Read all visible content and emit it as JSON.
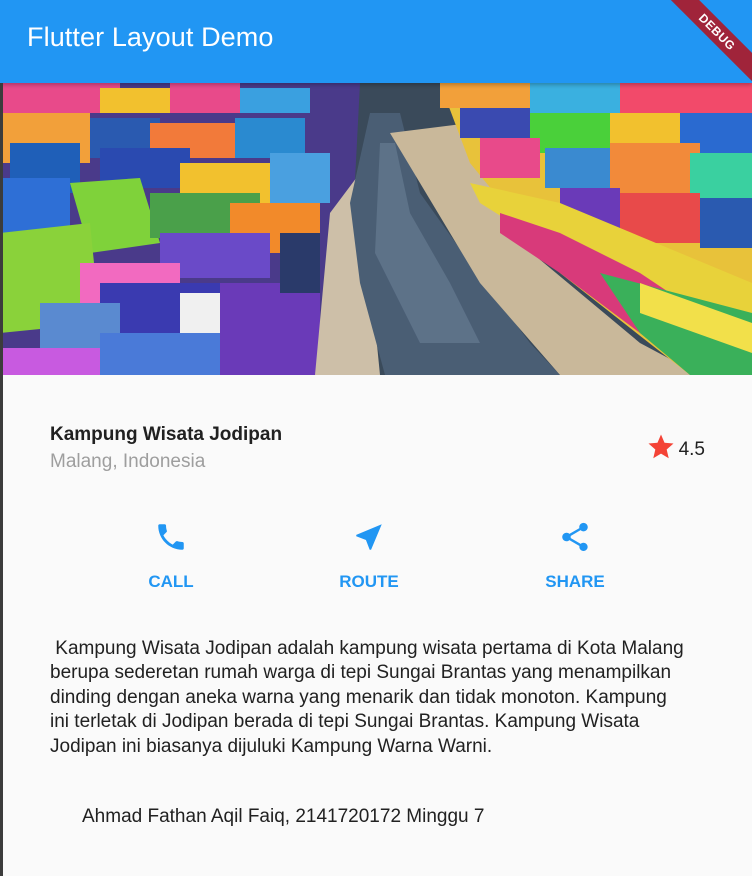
{
  "app_bar": {
    "title": "Flutter Layout Demo"
  },
  "debug_banner": {
    "label": "DEBUG"
  },
  "title_section": {
    "name": "Kampung Wisata Jodipan",
    "location": "Malang, Indonesia",
    "rating": "4.5",
    "star_icon": "star-icon",
    "star_color": "#f44336"
  },
  "buttons": [
    {
      "label": "CALL",
      "icon": "phone-icon"
    },
    {
      "label": "ROUTE",
      "icon": "navigation-icon"
    },
    {
      "label": "SHARE",
      "icon": "share-icon"
    }
  ],
  "description": " Kampung Wisata Jodipan adalah kampung wisata pertama di Kota Malang berupa sederetan rumah warga di tepi Sungai Brantas yang menampilkan dinding dengan aneka warna yang menarik dan tidak monoton. Kampung ini terletak di Jodipan berada di tepi Sungai Brantas. Kampung Wisata Jodipan ini biasanya dijuluki Kampung Warna Warni.",
  "footer_note": "Ahmad Fathan Aqil Faiq, 2141720172 Minggu 7",
  "colors": {
    "primary": "#2196f3",
    "star": "#f44336",
    "debug": "#a0243a"
  }
}
